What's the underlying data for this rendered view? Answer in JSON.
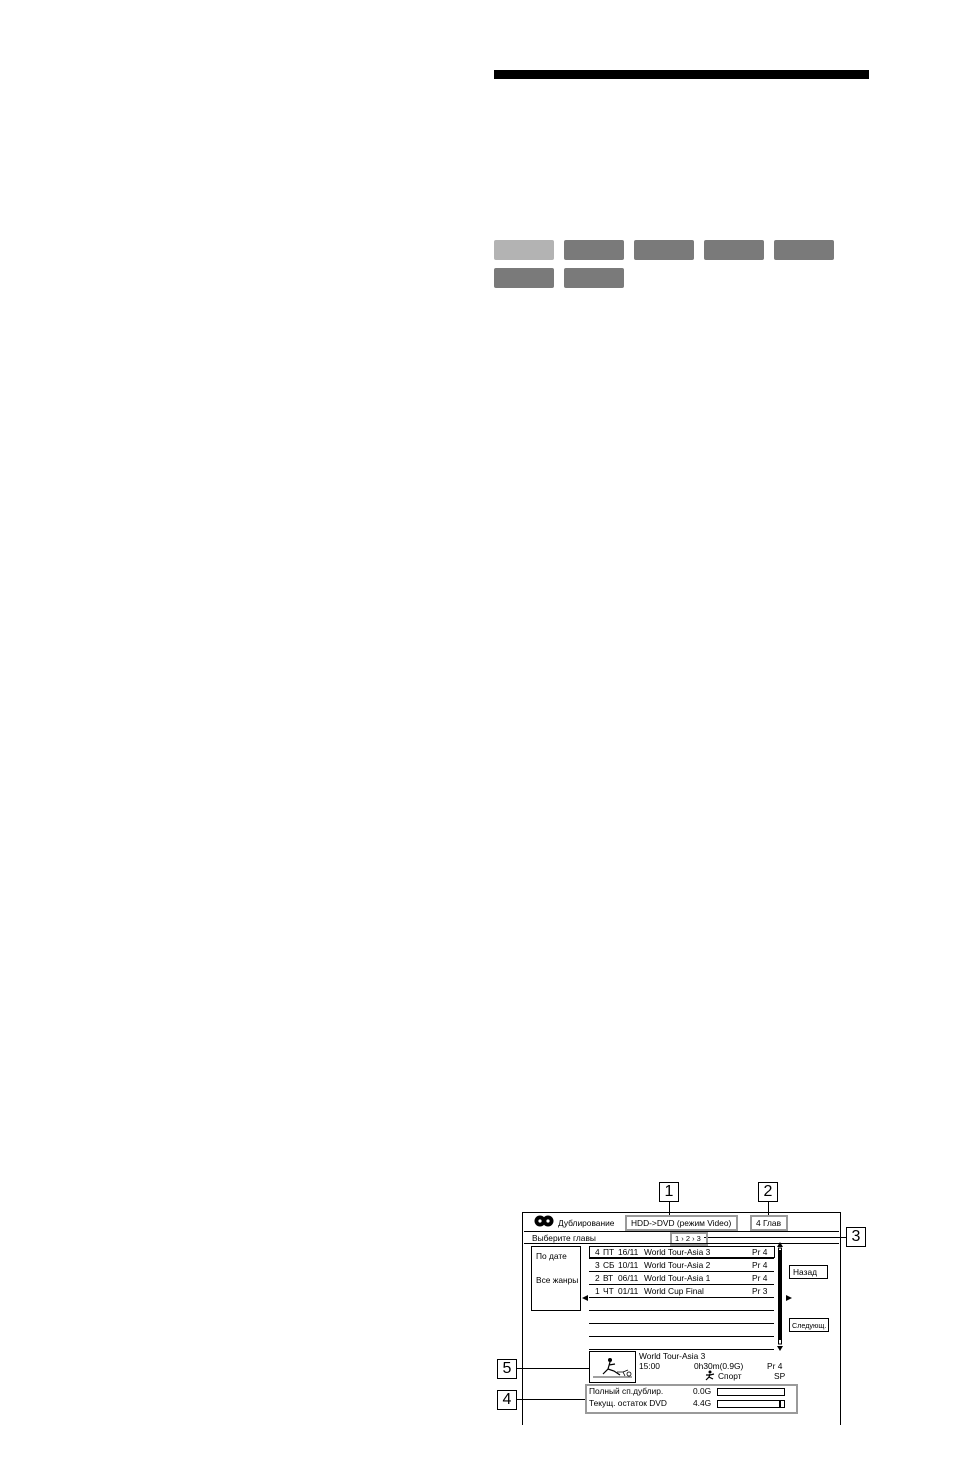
{
  "osd": {
    "title": "Дублирование",
    "mode": "HDD->DVD (режим Video)",
    "count": "4 Глав",
    "subtitle": "Выберите главы",
    "pages": "1 › 2 › 3",
    "sort_by_date": "По дате",
    "all_genres": "Все жанры",
    "rows": [
      {
        "num": "4",
        "day": "ПТ",
        "date": "16/11",
        "title": "World Tour-Asia 3",
        "pr": "Pr  4"
      },
      {
        "num": "3",
        "day": "СБ",
        "date": "10/11",
        "title": "World Tour-Asia 2",
        "pr": "Pr  4"
      },
      {
        "num": "2",
        "day": "ВТ",
        "date": "06/11",
        "title": "World Tour-Asia 1",
        "pr": "Pr  4"
      },
      {
        "num": "1",
        "day": "ЧТ",
        "date": "01/11",
        "title": "World Cup Final",
        "pr": "Pr  3"
      }
    ],
    "back_button": "Назад",
    "next_button": "Следующ.",
    "info": {
      "title": "World Tour-Asia 3",
      "time": "15:00",
      "duration": "0h30m(0.9G)",
      "channel": "Pr 4",
      "genre": "Спорт",
      "quality": "SP"
    },
    "total_label": "Полный сп.дублир.",
    "total_value": "0.0G",
    "total_fraction": 0.0,
    "remaining_label": "Текущ. остаток DVD",
    "remaining_value": "4.4G",
    "remaining_fraction": 0.95,
    "callouts": [
      "1",
      "2",
      "3",
      "4",
      "5"
    ]
  }
}
